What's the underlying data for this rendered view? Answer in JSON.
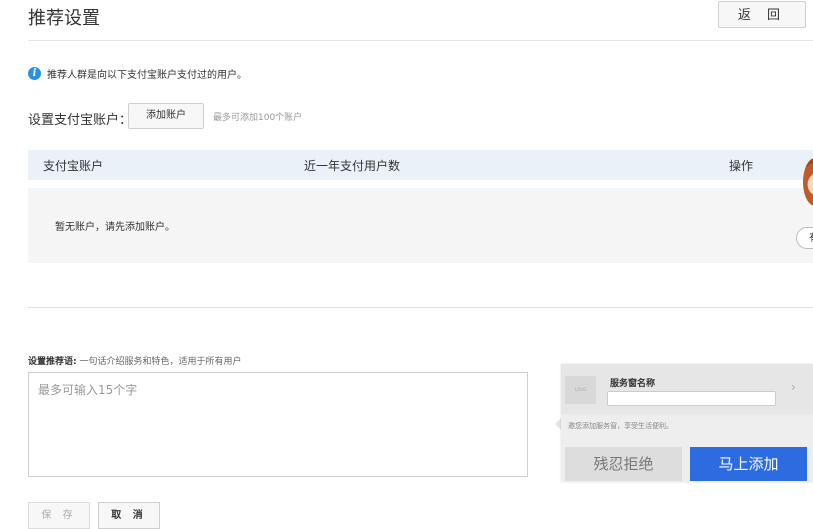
{
  "header": {
    "title": "推荐设置",
    "back_label": "返 回"
  },
  "notice": {
    "text": "推荐人群是向以下支付宝账户支付过的用户。",
    "icon": "info-icon"
  },
  "account": {
    "label": "设置支付宝账户：",
    "add_button": "添加账户",
    "limit_hint": "最多可添加100个账户"
  },
  "table": {
    "columns": [
      "支付宝账户",
      "近一年支付用户数",
      "操作"
    ],
    "empty_text": "暂无账户，请先添加账户。"
  },
  "side_widget": {
    "pill_text": "有"
  },
  "recommendation": {
    "label_bold": "设置推荐语:",
    "label_hint": "一句话介绍服务和特色，适用于所有用户",
    "placeholder": "最多可输入15个字"
  },
  "preview": {
    "logo_text": "LOGO",
    "service_name": "服务窗名称",
    "invite_text": "邀您添加服务窗，享受生活便利。",
    "reject_label": "残忍拒绝",
    "accept_label": "马上添加",
    "accent_color": "#2d6be0"
  },
  "footer": {
    "save_label": "保 存",
    "cancel_label": "取 消"
  }
}
